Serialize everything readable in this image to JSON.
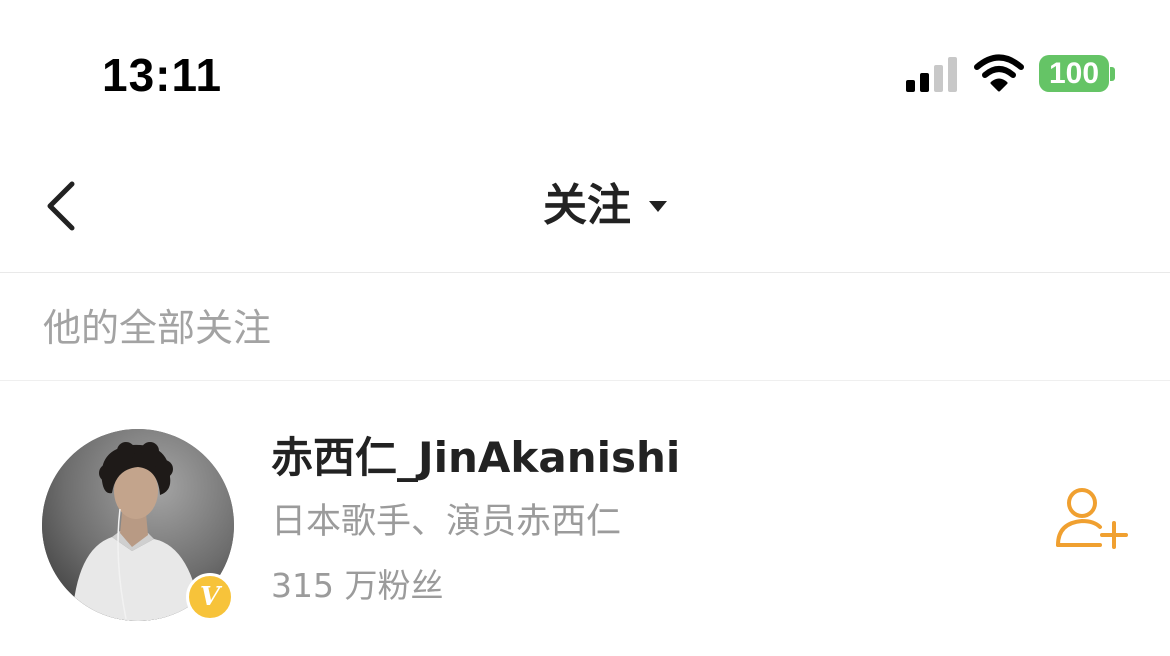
{
  "status_bar": {
    "time": "13:11",
    "battery": "100",
    "battery_color": "#65c466",
    "signal_active_color": "#000000",
    "signal_inactive_color": "#c8c8c8",
    "signal_bars_active": 2,
    "signal_bars_total": 4
  },
  "nav": {
    "title": "关注",
    "back_icon": "chevron-left-icon",
    "dropdown_icon": "caret-down-icon"
  },
  "section": {
    "title": "他的全部关注"
  },
  "users": [
    {
      "name": "赤西仁_JinAkanishi",
      "description": "日本歌手、演员赤西仁",
      "followers": "315 万粉丝",
      "verified_badge": "V",
      "verified_color": "#f7c33a",
      "follow_icon": "add-user-icon",
      "follow_color": "#f0a030"
    }
  ]
}
